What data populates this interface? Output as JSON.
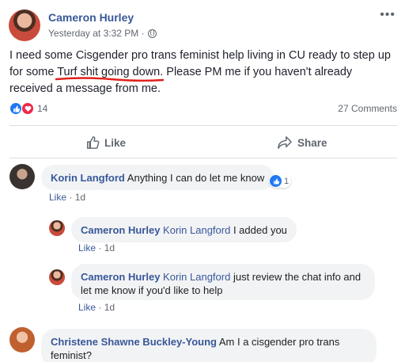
{
  "post": {
    "author": "Cameron Hurley",
    "timestamp": "Yesterday at 3:32 PM ·",
    "text_before": "I need some Cisgender pro trans feminist help living in CU ready to step up for some ",
    "text_underlined": "Turf shit going down",
    "text_after": ". Please PM me if you haven't already received a message from me.",
    "reaction_count": "14",
    "comments_count": "27 Comments",
    "like_label": "Like",
    "share_label": "Share",
    "underline_color": "#e0201b"
  },
  "comments": [
    {
      "author": "Korin Langford",
      "text": "Anything I can do let me know",
      "reaction_count": "1",
      "like_label": "Like",
      "age": "1d"
    },
    {
      "author": "Cameron Hurley",
      "mention": "Korin Langford",
      "text": "I added you",
      "like_label": "Like",
      "age": "1d"
    },
    {
      "author": "Cameron Hurley",
      "mention": "Korin Langford",
      "text": "just review the chat info and let me know if you'd like to help",
      "like_label": "Like",
      "age": "1d"
    },
    {
      "author": "Christene Shawne Buckley-Young",
      "text": "Am I a cisgender pro trans feminist?"
    }
  ],
  "icons": [
    "globe-icon",
    "more-icon",
    "like-icon",
    "share-icon",
    "like-reaction-icon",
    "love-reaction-icon"
  ]
}
